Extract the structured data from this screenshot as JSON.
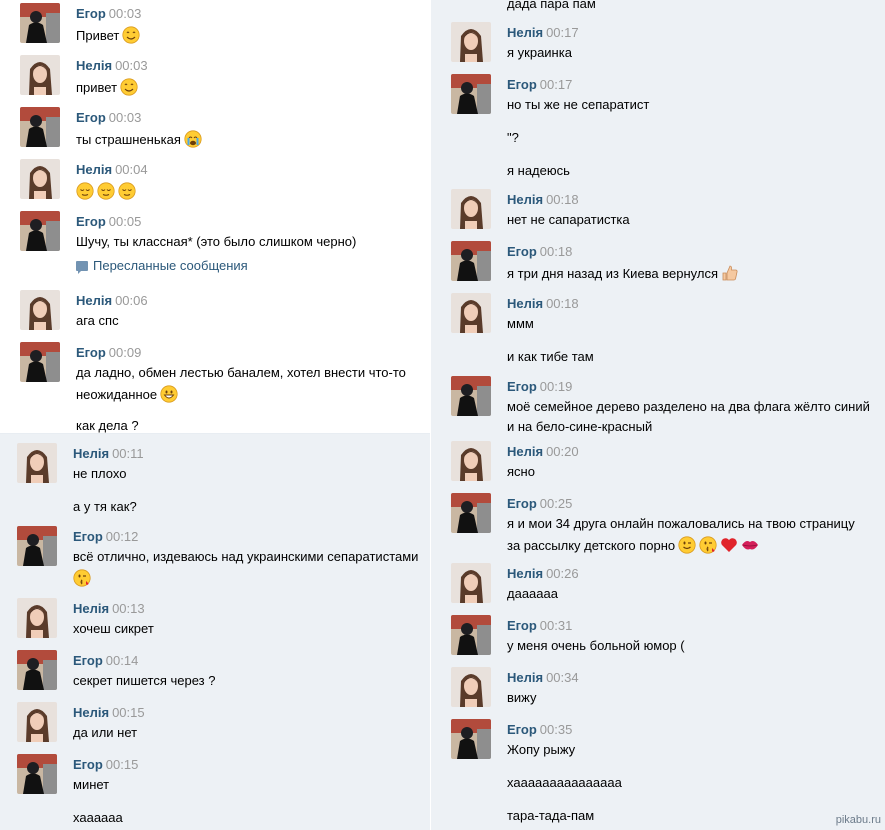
{
  "colors": {
    "name": "#2b587a",
    "time": "#999999",
    "panel_bg": "#edf1f5"
  },
  "panel_a": {
    "messages": [
      {
        "sender": "Егор",
        "time": "00:03",
        "lines": [
          {
            "text": "Привет",
            "emoji": [
              "smile-emoji"
            ]
          }
        ]
      },
      {
        "sender": "Нелія",
        "time": "00:03",
        "lines": [
          {
            "text": "привет",
            "emoji": [
              "smile-emoji"
            ]
          }
        ]
      },
      {
        "sender": "Егор",
        "time": "00:03",
        "lines": [
          {
            "text": "ты страшненькая",
            "emoji": [
              "crying-emoji"
            ]
          }
        ]
      },
      {
        "sender": "Нелія",
        "time": "00:04",
        "lines": [
          {
            "text": "",
            "emoji": [
              "relieved-emoji",
              "relieved-emoji",
              "relieved-emoji"
            ]
          }
        ]
      },
      {
        "sender": "Егор",
        "time": "00:05",
        "lines": [
          {
            "text": "Шучу, ты классная* (это было слишком черно)",
            "emoji": []
          }
        ],
        "forwarded": "Пересланные сообщения"
      },
      {
        "sender": "Нелія",
        "time": "00:06",
        "lines": [
          {
            "text": "ага спс",
            "emoji": []
          }
        ]
      },
      {
        "sender": "Егор",
        "time": "00:09",
        "lines": [
          {
            "text": "да ладно, обмен лестью баналем, хотел внести что-то",
            "emoji": []
          },
          {
            "text": "неожиданное",
            "emoji": [
              "grin-emoji"
            ]
          },
          {
            "text": "как дела ?",
            "emoji": [],
            "gap": true
          }
        ]
      }
    ]
  },
  "panel_b": {
    "messages": [
      {
        "sender": "Нелія",
        "time": "00:11",
        "lines": [
          {
            "text": "не плохо",
            "emoji": []
          },
          {
            "text": "а у тя как?",
            "emoji": [],
            "gap": true
          }
        ]
      },
      {
        "sender": "Егор",
        "time": "00:12",
        "lines": [
          {
            "text": "всё отлично, издеваюсь над украинскими сепаратистами",
            "emoji": []
          },
          {
            "text": "",
            "emoji": [
              "kiss-emoji"
            ]
          }
        ]
      },
      {
        "sender": "Нелія",
        "time": "00:13",
        "lines": [
          {
            "text": "хочеш сикрет",
            "emoji": []
          }
        ]
      },
      {
        "sender": "Егор",
        "time": "00:14",
        "lines": [
          {
            "text": "секрет пишется через ?",
            "emoji": []
          }
        ]
      },
      {
        "sender": "Нелія",
        "time": "00:15",
        "lines": [
          {
            "text": "да или нет",
            "emoji": []
          }
        ]
      },
      {
        "sender": "Егор",
        "time": "00:15",
        "lines": [
          {
            "text": "минет",
            "emoji": []
          },
          {
            "text": "хаааааа",
            "emoji": [],
            "gap": true
          }
        ]
      }
    ]
  },
  "panel_c": {
    "top_line": "дада пара пам",
    "messages": [
      {
        "sender": "Нелія",
        "time": "00:17",
        "lines": [
          {
            "text": "я украинка",
            "emoji": []
          }
        ]
      },
      {
        "sender": "Егор",
        "time": "00:17",
        "lines": [
          {
            "text": "но ты же не сепаратист",
            "emoji": []
          },
          {
            "text": "\"?",
            "emoji": [],
            "gap": true
          },
          {
            "text": "я надеюсь",
            "emoji": [],
            "gap": true
          }
        ]
      },
      {
        "sender": "Нелія",
        "time": "00:18",
        "lines": [
          {
            "text": "нет не сапаратистка",
            "emoji": []
          }
        ]
      },
      {
        "sender": "Егор",
        "time": "00:18",
        "lines": [
          {
            "text": "я три дня назад из Киева вернулся",
            "emoji": [
              "thumbs-up-emoji"
            ]
          }
        ]
      },
      {
        "sender": "Нелія",
        "time": "00:18",
        "lines": [
          {
            "text": "ммм",
            "emoji": []
          },
          {
            "text": "и как тибе там",
            "emoji": [],
            "gap": true
          }
        ]
      },
      {
        "sender": "Егор",
        "time": "00:19",
        "lines": [
          {
            "text": "моё семейное дерево разделено на два флага жёлто синий",
            "emoji": []
          },
          {
            "text": "и на бело-сине-красный",
            "emoji": []
          }
        ]
      },
      {
        "sender": "Нелія",
        "time": "00:20",
        "lines": [
          {
            "text": "ясно",
            "emoji": []
          }
        ]
      },
      {
        "sender": "Егор",
        "time": "00:25",
        "lines": [
          {
            "text": "я и мои 34 друга онлайн пожаловались на твою страницу",
            "emoji": []
          },
          {
            "text": "за рассылку детского порно",
            "emoji": [
              "wink-emoji",
              "kiss-emoji",
              "heart-emoji",
              "lips-emoji"
            ]
          }
        ]
      },
      {
        "sender": "Нелія",
        "time": "00:26",
        "lines": [
          {
            "text": "даааааа",
            "emoji": []
          }
        ]
      },
      {
        "sender": "Егор",
        "time": "00:31",
        "lines": [
          {
            "text": "у меня очень больной юмор (",
            "emoji": []
          }
        ]
      },
      {
        "sender": "Нелія",
        "time": "00:34",
        "lines": [
          {
            "text": "вижу",
            "emoji": []
          }
        ]
      },
      {
        "sender": "Егор",
        "time": "00:35",
        "lines": [
          {
            "text": "Жопу рыжу",
            "emoji": []
          },
          {
            "text": "хааааааааааааааа",
            "emoji": [],
            "gap": true
          },
          {
            "text": "тара-тада-пам",
            "emoji": [],
            "gap": true
          }
        ]
      }
    ]
  },
  "watermark": "pikabu.ru"
}
